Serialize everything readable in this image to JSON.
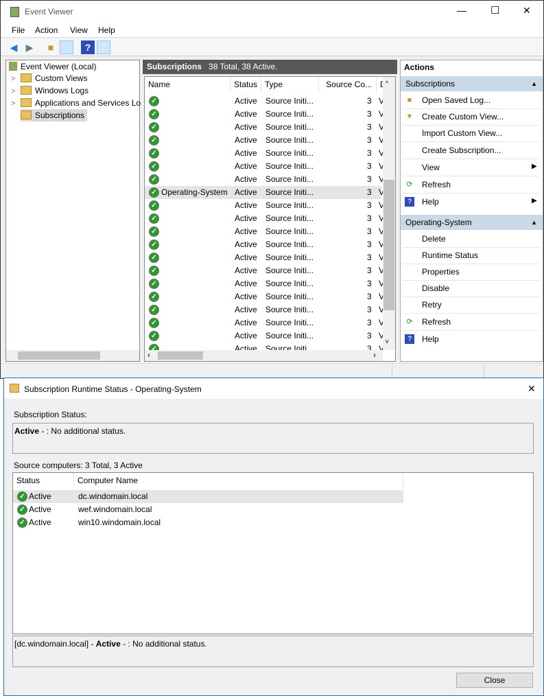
{
  "window": {
    "title": "Event Viewer",
    "controls": {
      "minimize": "—",
      "maximize": "☐",
      "close": "✕"
    }
  },
  "menu": [
    "File",
    "Action",
    "View",
    "Help"
  ],
  "tree": {
    "root": "Event Viewer (Local)",
    "items": [
      "Custom Views",
      "Windows Logs",
      "Applications and Services Lo",
      "Subscriptions"
    ]
  },
  "subscriptions": {
    "title": "Subscriptions",
    "summary": "38 Total, 38 Active.",
    "columns": [
      "Name",
      "Status",
      "Type",
      "Source Co...",
      "D"
    ],
    "rows_status": "Active",
    "rows_type": "Source Initi...",
    "rows_count": "3",
    "rows_d": "V",
    "selected_name": "Operating-System",
    "visible_rows": 19,
    "selected_index": 7
  },
  "actions": {
    "title": "Actions",
    "section1": {
      "title": "Subscriptions",
      "items": [
        "Open Saved Log...",
        "Create Custom View...",
        "Import Custom View...",
        "Create Subscription...",
        "View",
        "Refresh",
        "Help"
      ]
    },
    "section2": {
      "title": "Operating-System",
      "items": [
        "Delete",
        "Runtime Status",
        "Properties",
        "Disable",
        "Retry",
        "Refresh",
        "Help"
      ]
    }
  },
  "dialog": {
    "title": "Subscription Runtime Status - Operating-System",
    "close": "✕",
    "status_label": "Subscription Status:",
    "status_bold": "Active",
    "status_text": " - : No additional status.",
    "sources_label": "Source computers: 3 Total, 3 Active",
    "columns": [
      "Status",
      "Computer Name"
    ],
    "rows": [
      {
        "status": "Active",
        "name": "dc.windomain.local"
      },
      {
        "status": "Active",
        "name": "wef.windomain.local"
      },
      {
        "status": "Active",
        "name": "win10.windomain.local"
      }
    ],
    "detail_prefix": "[dc.windomain.local] - ",
    "detail_bold": "Active",
    "detail_text": " - : No additional status.",
    "close_button": "Close"
  },
  "colors": {
    "header_dark": "#595959",
    "section_blue": "#c9d9e8",
    "active_green": "#2e9a2e"
  }
}
